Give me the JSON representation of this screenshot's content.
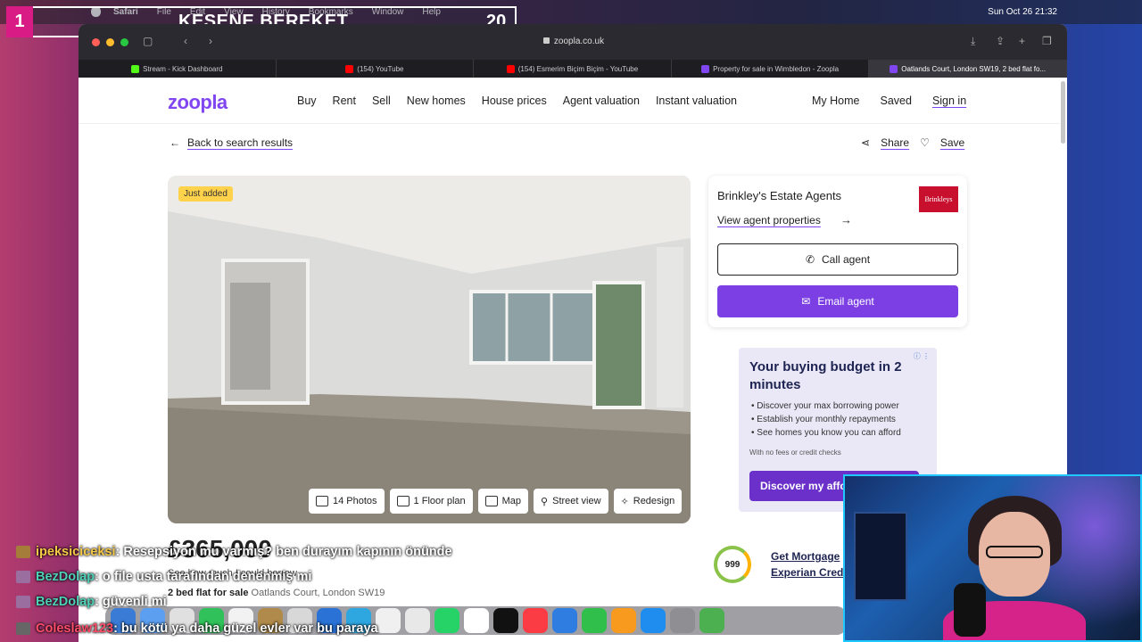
{
  "menubar": {
    "app": "Safari",
    "menus": [
      "File",
      "Edit",
      "View",
      "History",
      "Bookmarks",
      "Window",
      "Help"
    ],
    "clock": "Sun Oct 26  21:32"
  },
  "stream": {
    "number": "1",
    "title": "KESENE BEREKET",
    "count": "20"
  },
  "browser": {
    "url": "zoopla.co.uk",
    "tabs": [
      {
        "label": "Stream - Kick Dashboard",
        "color": "#53fc18"
      },
      {
        "label": "(154) YouTube",
        "color": "#ff0000"
      },
      {
        "label": "(154) Esmerim Biçim Biçim - YouTube",
        "color": "#ff0000"
      },
      {
        "label": "Property for sale in Wimbledon - Zoopla",
        "color": "#8046f1"
      },
      {
        "label": "Oatlands Court, London SW19, 2 bed flat fo...",
        "color": "#8046f1"
      }
    ]
  },
  "site": {
    "logo": "zoopla",
    "nav": [
      "Buy",
      "Rent",
      "Sell",
      "New homes",
      "House prices",
      "Agent valuation",
      "Instant valuation"
    ],
    "my_home": "My Home",
    "saved": "Saved",
    "sign_in": "Sign in",
    "back": "Back to search results",
    "share": "Share",
    "save": "Save",
    "brand_color": "#8046f1"
  },
  "listing": {
    "badge": "Just added",
    "actions": [
      "14 Photos",
      "1 Floor plan",
      "Map",
      "Street view",
      "Redesign"
    ],
    "price": "£365,000",
    "subline": "See how much I could borrow",
    "type": "2 bed flat for sale",
    "address": "Oatlands Court, London SW19"
  },
  "agent": {
    "name": "Brinkley's Estate Agents",
    "logo_text": "Brinkleys",
    "view_props": "View agent properties",
    "call": "Call agent",
    "email": "Email agent"
  },
  "ad": {
    "title": "Your buying budget in 2 minutes",
    "items": [
      "Discover your max borrowing power",
      "Establish your monthly repayments",
      "See homes you know you can afford"
    ],
    "note": "With no fees or credit checks",
    "cta": "Discover my affordability"
  },
  "mortgage": {
    "score": "999",
    "line1": "Get Mortgage",
    "line2": "Experian Cred"
  },
  "chat": [
    {
      "user": "ipeksiciceksi",
      "msg": ": Resepsiyon mu varmış? ben durayım kapının önünde"
    },
    {
      "user": "BezDolap",
      "msg": ": o file usta tarafından denenmiş mi"
    },
    {
      "user": "BezDolap",
      "msg": ": güvenli mi"
    },
    {
      "user": "Coleslaw123",
      "msg": ": bu kötü ya daha güzel evler var bu paraya"
    }
  ]
}
